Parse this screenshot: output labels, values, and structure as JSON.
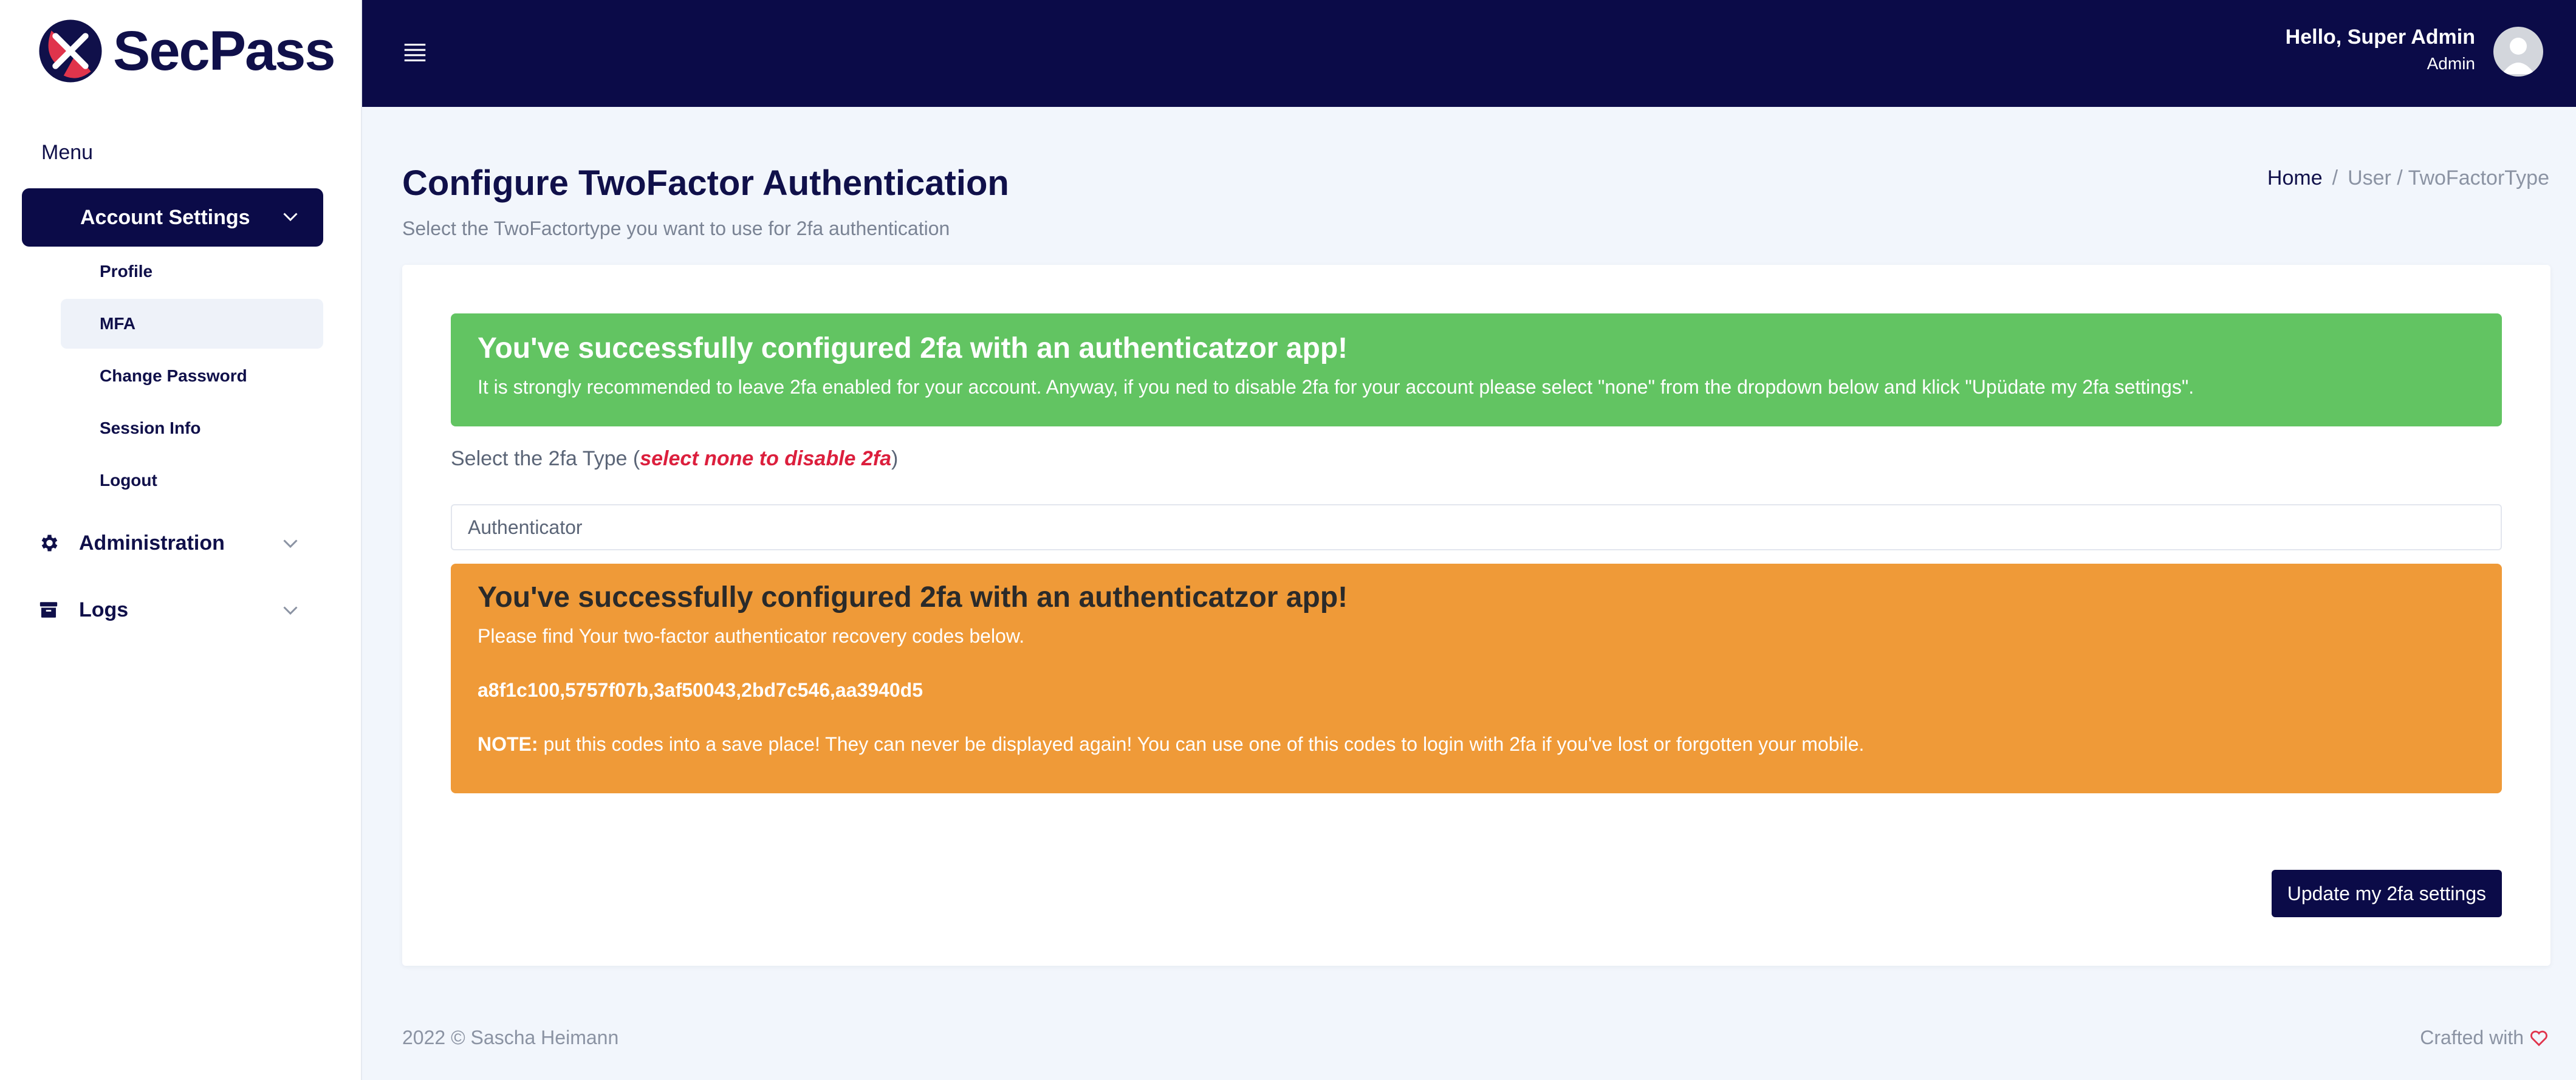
{
  "app": {
    "name": "SecPass"
  },
  "colors": {
    "brand_navy": "#0b0b48",
    "success_green": "#62c462",
    "warning_orange": "#ef9a38",
    "danger_red": "#dc1f3d",
    "logo_red": "#e0344c"
  },
  "sidebar": {
    "menu_title": "Menu",
    "account_settings": "Account Settings",
    "sub_items": [
      {
        "label": "Profile"
      },
      {
        "label": "MFA"
      },
      {
        "label": "Change Password"
      },
      {
        "label": "Session Info"
      },
      {
        "label": "Logout"
      }
    ],
    "administration": "Administration",
    "logs": "Logs"
  },
  "topbar": {
    "greeting": "Hello, Super Admin",
    "role": "Admin"
  },
  "page": {
    "title": "Configure TwoFactor Authentication",
    "subtitle": "Select the TwoFactortype you want to use for 2fa authentication",
    "breadcrumb": {
      "home": "Home",
      "separator": "/",
      "current": "User / TwoFactorType"
    }
  },
  "alert_success": {
    "title": "You've successfully configured 2fa with an authenticatzor app!",
    "text": "It is strongly recommended to leave 2fa enabled for your account. Anyway, if you ned to disable 2fa for your account please select \"none\" from the dropdown below and klick \"Upüdate my 2fa settings\"."
  },
  "form": {
    "label_prefix": "Select the 2fa Type (",
    "label_hint": "select none to disable 2fa",
    "label_suffix": ")",
    "selected_value": "Authenticator"
  },
  "alert_codes": {
    "title": "You've successfully configured 2fa with an authenticatzor app!",
    "intro": "Please find Your two-factor authenticator recovery codes below.",
    "codes": "a8f1c100,5757f07b,3af50043,2bd7c546,aa3940d5",
    "note_label": "NOTE:",
    "note_text": " put this codes into a save place! They can never be displayed again! You can use one of this codes to login with 2fa if you've lost or forgotten your mobile."
  },
  "buttons": {
    "update": "Update my 2fa settings"
  },
  "footer": {
    "copyright": "2022 © Sascha Heimann",
    "crafted": "Crafted with"
  },
  "icons": {
    "logo": "secpass-logo-icon",
    "menu": "hamburger-icon",
    "avatar": "user-avatar-icon",
    "administration": "gear-icon",
    "logs": "archive-box-icon",
    "expand": "chevron-down-icon",
    "heart": "heart-icon"
  }
}
